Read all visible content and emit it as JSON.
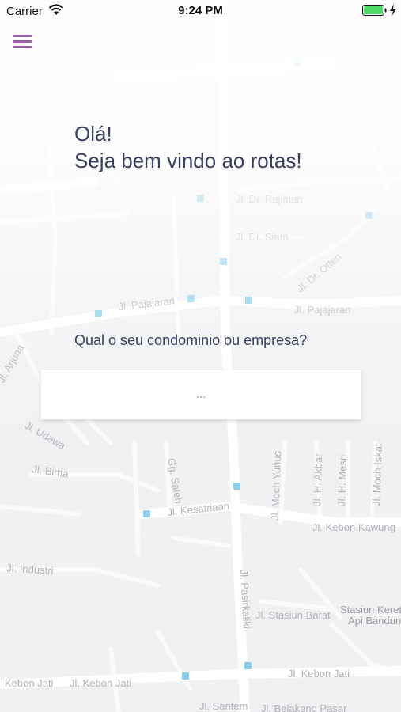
{
  "status_bar": {
    "carrier": "Carrier",
    "time": "9:24 PM",
    "wifi_icon": "wifi-icon",
    "battery_icon": "battery-icon",
    "charging_icon": "bolt-icon"
  },
  "header": {
    "menu_icon": "hamburger-menu-icon",
    "accent_color": "#9a5fa6"
  },
  "welcome": {
    "line1": "Olá!",
    "line2": "Seja bem vindo ao rotas!",
    "text_color": "#3b3d62"
  },
  "question": {
    "label": "Qual o seu condominio ou empresa?",
    "placeholder": "..."
  },
  "map": {
    "labels": [
      "Jl. Dr. Rajiman",
      "Jl. Pajajaran",
      "Jl. Pajajaran",
      "Jl. Bima",
      "Jl. Kesatriaan",
      "Jl. Kebon Kawung",
      "Jl. Industri",
      "Jl. Pasirkaliki",
      "Jl. Stasiun Barat",
      "Stasiun Kereta",
      "Api Bandung",
      "Kebon Jati",
      "Jl. Kebon Jati",
      "Jl. Kebon Jati",
      "Jl. Saritem",
      "Jl. Belakang Pasar",
      "Jl. Moch Yunus",
      "Jl. H. Akbar",
      "Jl. H. Mesri",
      "Jl. Moch Iskat",
      "Gg. Saleh",
      "Jl. Arjuna",
      "Jl. Udawa",
      "Jl. Dr. Otten",
      "Jl. Dr. Siam"
    ]
  }
}
